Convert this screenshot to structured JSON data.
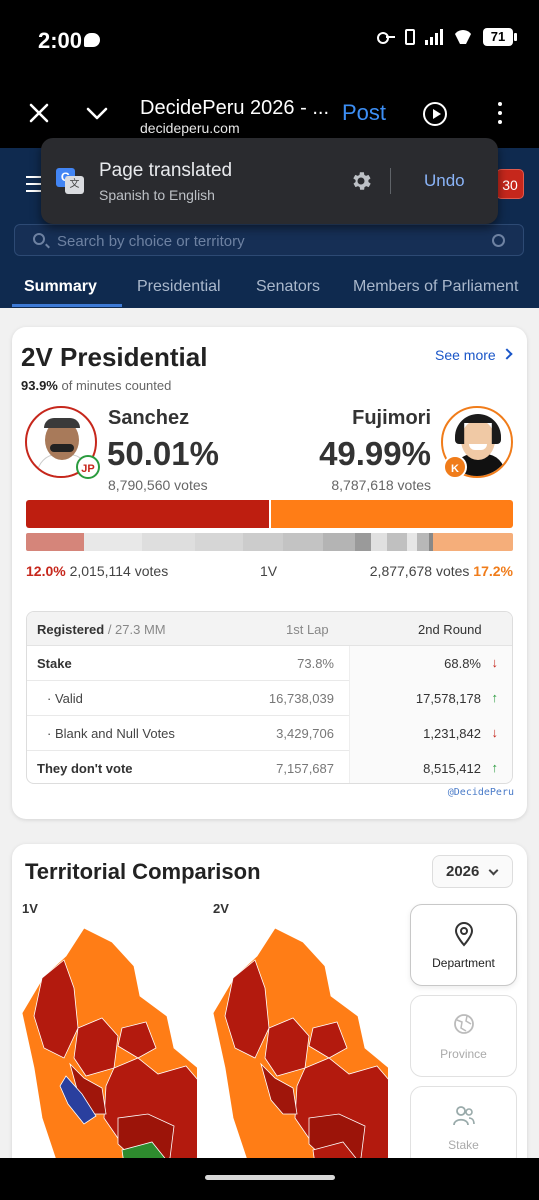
{
  "status": {
    "time": "2:00",
    "battery": "71"
  },
  "browser": {
    "title": "DecidePeru 2026 - ...",
    "domain": "decideperu.com",
    "post_label": "Post"
  },
  "translate_popup": {
    "title": "Page translated",
    "subtitle": "Spanish to English",
    "undo_label": "Undo"
  },
  "header": {
    "badge": "30",
    "search_placeholder": "Search by choice or territory",
    "tabs": [
      "Summary",
      "Presidential",
      "Senators",
      "Members of Parliament"
    ],
    "active_tab": "Summary"
  },
  "presidential": {
    "title": "2V Presidential",
    "see_more": "See more",
    "counted_pct": "93.9%",
    "counted_text": "of minutes counted",
    "left": {
      "name": "Sanchez",
      "pct": "50.01%",
      "votes": "8,790,560 votes",
      "party_logo": "JP",
      "color": "#be1e10"
    },
    "right": {
      "name": "Fujimori",
      "pct": "49.99%",
      "votes": "8,787,618 votes",
      "party_logo": "K",
      "color": "#ff7d16"
    },
    "bar_share": {
      "left": 50.01,
      "right": 49.99
    },
    "first_round": {
      "left_pct": "12.0%",
      "left_votes": "2,015,114 votes",
      "label": "1V",
      "right_votes": "2,877,678 votes",
      "right_pct": "17.2%"
    },
    "table": {
      "registered_label": "Registered",
      "registered_value": "/ 27.3 MM",
      "col_first": "1st Lap",
      "col_second": "2nd Round",
      "rows": [
        {
          "label": "Stake",
          "first": "73.8%",
          "second": "68.8%",
          "trend": "down"
        },
        {
          "label": "· Valid",
          "first": "16,738,039",
          "second": "17,578,178",
          "trend": "up"
        },
        {
          "label": "· Blank and Null Votes",
          "first": "3,429,706",
          "second": "1,231,842",
          "trend": "down"
        },
        {
          "label": "They don't vote",
          "first": "7,157,687",
          "second": "8,515,412",
          "trend": "up"
        }
      ]
    },
    "credit": "@DecidePeru"
  },
  "territorial": {
    "title": "Territorial Comparison",
    "year": "2026",
    "map_labels": [
      "1V",
      "2V"
    ],
    "options": [
      {
        "label": "Department",
        "icon": "location-pin-icon",
        "active": true
      },
      {
        "label": "Province",
        "icon": "globe-icon",
        "active": false
      },
      {
        "label": "Stake",
        "icon": "people-icon",
        "active": false
      }
    ]
  }
}
